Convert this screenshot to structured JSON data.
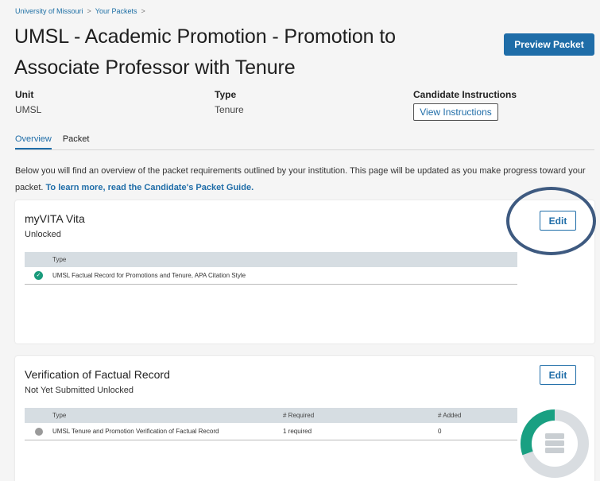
{
  "breadcrumb": {
    "items": [
      "University of Missouri",
      "Your Packets"
    ],
    "separator": ">"
  },
  "page": {
    "title": "UMSL - Academic Promotion - Promotion to Associate Professor with Tenure",
    "preview_label": "Preview Packet"
  },
  "meta": {
    "unit_label": "Unit",
    "unit_value": "UMSL",
    "type_label": "Type",
    "type_value": "Tenure",
    "instructions_label": "Candidate Instructions",
    "instructions_button": "View Instructions"
  },
  "tabs": [
    {
      "label": "Overview",
      "active": true
    },
    {
      "label": "Packet",
      "active": false
    }
  ],
  "intro": {
    "text": "Below you will find an overview of the packet requirements outlined by your institution. This page will be updated as you make progress toward your packet.",
    "link": "To learn more, read the Candidate's Packet Guide."
  },
  "cards": {
    "vita": {
      "title": "myVITA Vita",
      "status": "Unlocked",
      "edit_label": "Edit",
      "col_type": "Type",
      "row": {
        "type": "UMSL Factual Record for Promotions and Tenure, APA Citation Style",
        "icon": "check-circle-icon"
      }
    },
    "verification": {
      "title": "Verification of Factual Record",
      "status": "Not Yet Submitted Unlocked",
      "edit_label": "Edit",
      "col_type": "Type",
      "col_required": "# Required",
      "col_added": "# Added",
      "row": {
        "type": "UMSL Tenure and Promotion Verification of Factual Record",
        "required": "1 required",
        "added": "0",
        "icon": "gray-dot-icon"
      }
    }
  },
  "colors": {
    "accent": "#1f6da8",
    "success": "#1a9b7c",
    "highlight": "#3e5a80"
  }
}
